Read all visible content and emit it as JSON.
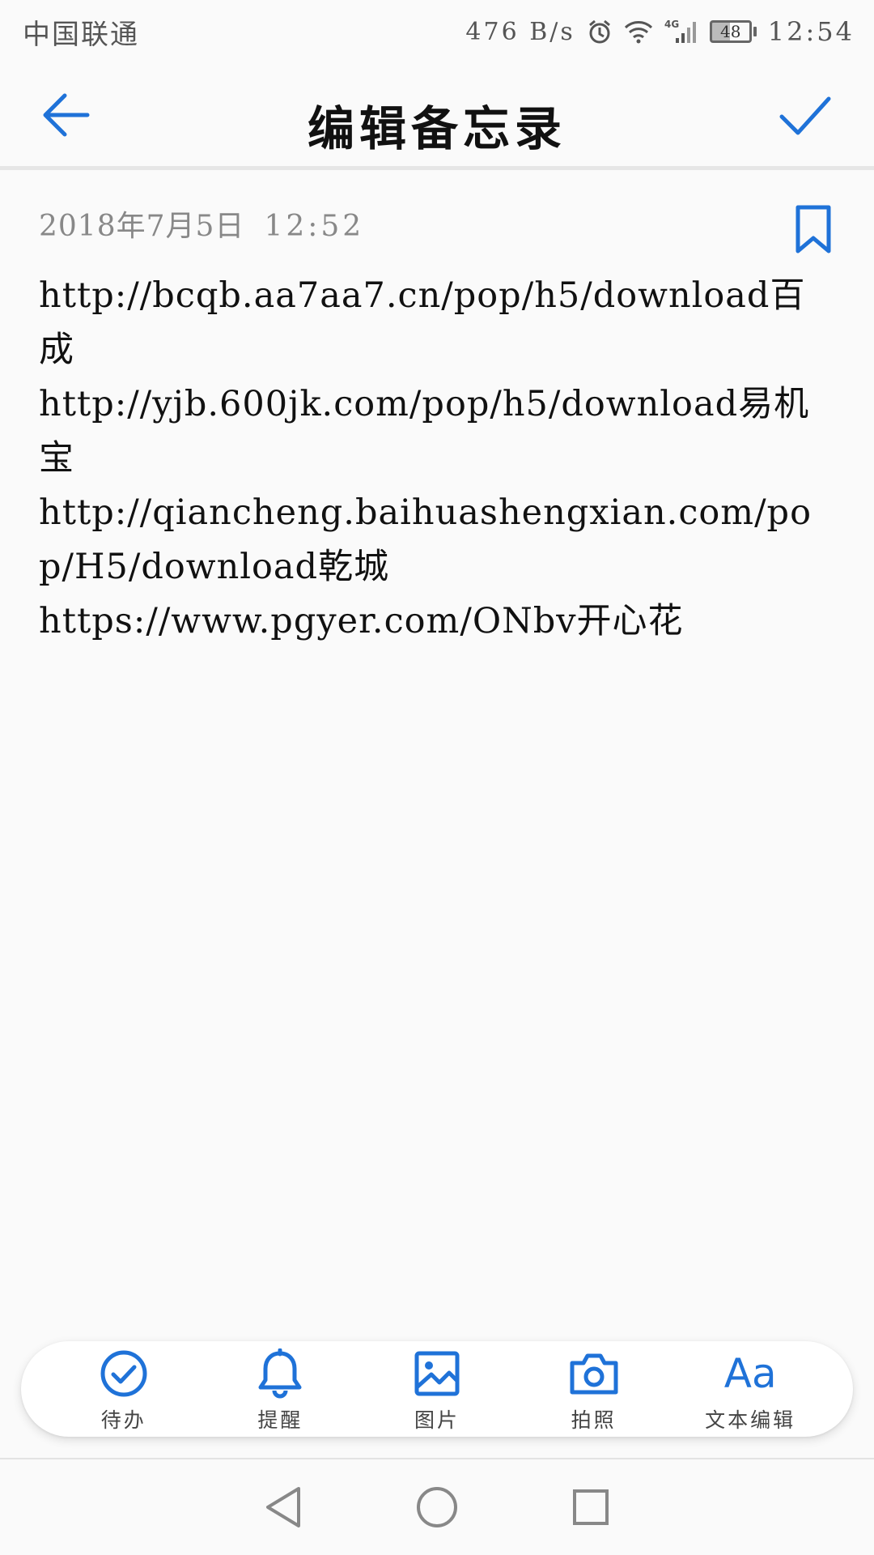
{
  "status_bar": {
    "carrier": "中国联通",
    "speed": "476 B/s",
    "network": "4G",
    "battery": "48",
    "time": "12:54"
  },
  "header": {
    "title": "编辑备忘录",
    "back_icon": "arrow-left-icon",
    "confirm_icon": "check-icon"
  },
  "note": {
    "date": "2018年7月5日",
    "time": "12:52",
    "lines": [
      "http://bcqb.aa7aa7.cn/pop/h5/download百成",
      "http://yjb.600jk.com/pop/h5/download易机宝",
      "http://qiancheng.baihuashengxian.com/pop/H5/download乾城",
      "https://www.pgyer.com/ONbv开心花"
    ]
  },
  "toolbar": {
    "items": [
      {
        "label": "待办",
        "icon": "check-circle-icon"
      },
      {
        "label": "提醒",
        "icon": "bell-icon"
      },
      {
        "label": "图片",
        "icon": "image-icon"
      },
      {
        "label": "拍照",
        "icon": "camera-icon"
      },
      {
        "label": "文本编辑",
        "icon": "text-format-icon",
        "glyph": "Aa"
      }
    ]
  },
  "colors": {
    "accent": "#1f72d8",
    "background": "#fafafa"
  }
}
